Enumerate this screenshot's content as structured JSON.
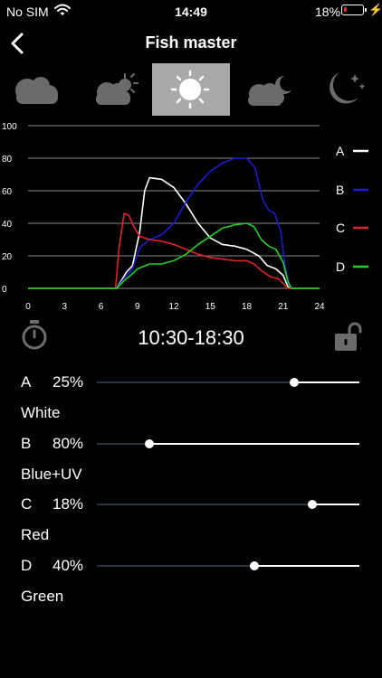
{
  "status_bar": {
    "carrier": "No SIM",
    "time": "14:49",
    "battery_percent": "18%",
    "battery_level": 0.18,
    "charging": true
  },
  "nav": {
    "title": "Fish master",
    "back_icon": "chevron-left-icon"
  },
  "modes": [
    {
      "name": "cloudy",
      "icon": "cloud-icon",
      "selected": false
    },
    {
      "name": "partly-sunny",
      "icon": "cloud-sun-icon",
      "selected": false
    },
    {
      "name": "sunny",
      "icon": "sun-icon",
      "selected": true
    },
    {
      "name": "cloudy-night",
      "icon": "cloud-moon-icon",
      "selected": false
    },
    {
      "name": "night",
      "icon": "moon-stars-icon",
      "selected": false
    }
  ],
  "chart_data": {
    "type": "line",
    "x_ticks": [
      0,
      3,
      6,
      9,
      12,
      15,
      18,
      21,
      24
    ],
    "y_ticks": [
      0,
      20,
      40,
      60,
      80,
      100
    ],
    "xlim": [
      0,
      24
    ],
    "ylim": [
      0,
      100
    ],
    "grid": true,
    "legend_position": "right",
    "series": [
      {
        "name": "A",
        "color": "#ffffff",
        "points": [
          [
            0,
            0
          ],
          [
            7.3,
            0
          ],
          [
            7.7,
            5
          ],
          [
            8.1,
            10
          ],
          [
            8.6,
            14
          ],
          [
            9.2,
            35
          ],
          [
            9.6,
            60
          ],
          [
            10,
            68
          ],
          [
            11,
            67
          ],
          [
            12,
            62
          ],
          [
            13,
            52
          ],
          [
            14,
            40
          ],
          [
            15,
            31
          ],
          [
            16,
            27
          ],
          [
            17,
            26
          ],
          [
            18,
            24
          ],
          [
            19,
            20
          ],
          [
            19.7,
            14
          ],
          [
            20.4,
            12
          ],
          [
            21,
            8
          ],
          [
            21.4,
            1
          ],
          [
            21.7,
            0
          ],
          [
            24,
            0
          ]
        ]
      },
      {
        "name": "B",
        "color": "#1b1bd0",
        "points": [
          [
            0,
            0
          ],
          [
            7.3,
            0
          ],
          [
            7.7,
            4
          ],
          [
            8.1,
            8
          ],
          [
            8.6,
            12
          ],
          [
            9.2,
            25
          ],
          [
            10,
            30
          ],
          [
            11,
            33
          ],
          [
            12,
            40
          ],
          [
            13,
            53
          ],
          [
            14,
            64
          ],
          [
            15,
            72
          ],
          [
            16,
            77
          ],
          [
            17,
            80
          ],
          [
            18,
            80
          ],
          [
            18.7,
            74
          ],
          [
            19.3,
            55
          ],
          [
            19.8,
            48
          ],
          [
            20.3,
            46
          ],
          [
            20.8,
            35
          ],
          [
            21.2,
            12
          ],
          [
            21.6,
            0
          ],
          [
            24,
            0
          ]
        ]
      },
      {
        "name": "C",
        "color": "#e02424",
        "points": [
          [
            0,
            0
          ],
          [
            7.2,
            0
          ],
          [
            7.5,
            25
          ],
          [
            7.9,
            46
          ],
          [
            8.3,
            45
          ],
          [
            8.7,
            38
          ],
          [
            9.2,
            32
          ],
          [
            10,
            30
          ],
          [
            11,
            29
          ],
          [
            12,
            27
          ],
          [
            13,
            24
          ],
          [
            14,
            21
          ],
          [
            15,
            19
          ],
          [
            16,
            18
          ],
          [
            17,
            17
          ],
          [
            18,
            17
          ],
          [
            18.6,
            15
          ],
          [
            19.2,
            11
          ],
          [
            20,
            7
          ],
          [
            20.6,
            6
          ],
          [
            21,
            3
          ],
          [
            21.4,
            0
          ],
          [
            24,
            0
          ]
        ]
      },
      {
        "name": "D",
        "color": "#22d022",
        "points": [
          [
            0,
            0
          ],
          [
            7.3,
            0
          ],
          [
            7.7,
            3
          ],
          [
            8.1,
            6
          ],
          [
            8.6,
            9
          ],
          [
            9,
            12
          ],
          [
            10,
            15
          ],
          [
            11,
            15
          ],
          [
            12,
            17
          ],
          [
            13,
            21
          ],
          [
            14,
            27
          ],
          [
            15,
            32
          ],
          [
            16,
            37
          ],
          [
            17,
            39
          ],
          [
            18,
            40
          ],
          [
            18.6,
            38
          ],
          [
            19.2,
            30
          ],
          [
            19.8,
            26
          ],
          [
            20.4,
            24
          ],
          [
            21,
            16
          ],
          [
            21.4,
            4
          ],
          [
            21.7,
            0
          ],
          [
            24,
            0
          ]
        ]
      }
    ]
  },
  "time_range": "10:30-18:30",
  "timer_icon": "stopwatch-icon",
  "lock_icon": "unlock-icon",
  "channels": [
    {
      "letter": "A",
      "percent": "25%",
      "name": "White",
      "slider_value": 0.75
    },
    {
      "letter": "B",
      "percent": "80%",
      "name": "Blue+UV",
      "slider_value": 0.2
    },
    {
      "letter": "C",
      "percent": "18%",
      "name": "Red",
      "slider_value": 0.82
    },
    {
      "letter": "D",
      "percent": "40%",
      "name": "Green",
      "slider_value": 0.6
    }
  ]
}
